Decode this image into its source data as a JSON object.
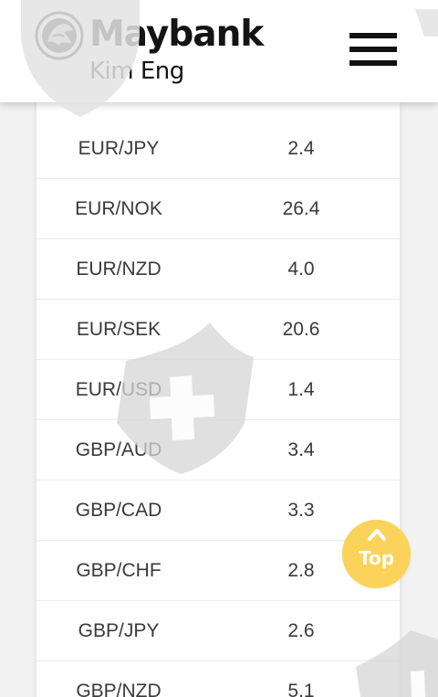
{
  "header": {
    "brand": "Maybank",
    "brand_sub": "Kim Eng",
    "logo_icon": "tiger-emblem-icon",
    "menu_icon": "hamburger-menu-icon"
  },
  "table": {
    "rows": [
      {
        "pair": "EUR/JPY",
        "value": "2.4"
      },
      {
        "pair": "EUR/NOK",
        "value": "26.4"
      },
      {
        "pair": "EUR/NZD",
        "value": "4.0"
      },
      {
        "pair": "EUR/SEK",
        "value": "20.6"
      },
      {
        "pair": "EUR/USD",
        "value": "1.4"
      },
      {
        "pair": "GBP/AUD",
        "value": "3.4"
      },
      {
        "pair": "GBP/CAD",
        "value": "3.3"
      },
      {
        "pair": "GBP/CHF",
        "value": "2.8"
      },
      {
        "pair": "GBP/JPY",
        "value": "2.6"
      },
      {
        "pair": "GBP/NZD",
        "value": "5.1"
      }
    ]
  },
  "back_to_top": {
    "label": "Top",
    "icon": "chevron-up-icon",
    "color": "#fbd35a"
  },
  "colors": {
    "text": "#3a3a3a",
    "watermark": "#d9d9d9"
  }
}
